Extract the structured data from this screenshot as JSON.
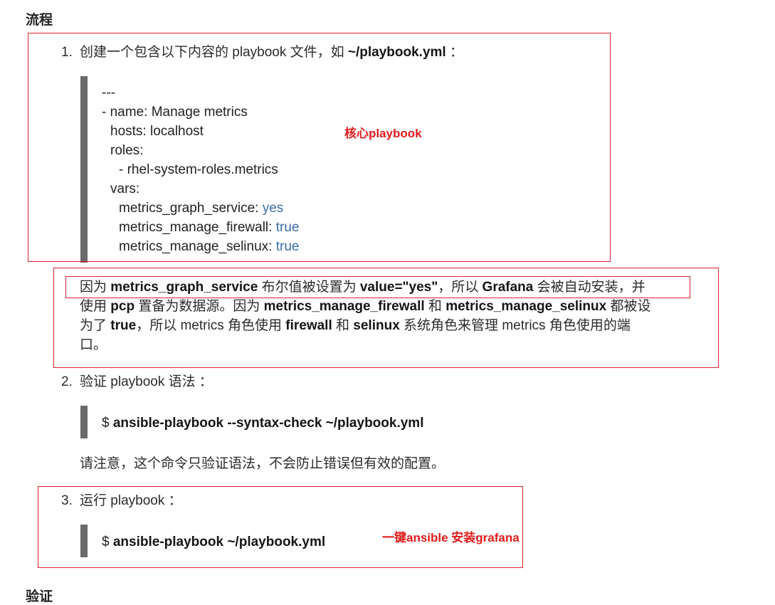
{
  "heading_flow": "流程",
  "heading_verify": "验证",
  "step1": {
    "number": "1.",
    "text_before": "创建一个包含以下内容的 playbook 文件，如 ",
    "path": "~/playbook.yml",
    "text_after": " ：",
    "code": {
      "line1": "---",
      "line2": "- name: Manage metrics",
      "line3": "hosts: localhost",
      "line4": "roles:",
      "line5": "- rhel-system-roles.metrics",
      "line6": "vars:",
      "line7_key": "metrics_graph_service: ",
      "line7_val": "yes",
      "line8_key": "metrics_manage_firewall: ",
      "line8_val": "true",
      "line9_key": "metrics_manage_selinux: ",
      "line9_val": "true"
    },
    "annotation": "核心playbook"
  },
  "explanation": {
    "l1_a": "因为 ",
    "l1_b": "metrics_graph_service",
    "l1_c": " 布尔值被设置为 ",
    "l1_d": "value=\"yes\"",
    "l1_e": "，所以 ",
    "l1_f": "Grafana",
    "l1_g": " 会被自动安装，并",
    "l2_a": "使用 ",
    "l2_b": "pcp",
    "l2_c": " 置备为数据源。因为 ",
    "l2_d": "metrics_manage_firewall",
    "l2_e": " 和 ",
    "l2_f": "metrics_manage_selinux",
    "l2_g": " 都被设",
    "l3_a": "为了 ",
    "l3_b": "true",
    "l3_c": "，所以 metrics 角色使用 ",
    "l3_d": "firewall",
    "l3_e": " 和 ",
    "l3_f": "selinux",
    "l3_g": " 系统角色来管理 metrics 角色使用的端",
    "l4": "口。"
  },
  "step2": {
    "number": "2.",
    "text": "验证 playbook 语法 ：",
    "prompt": "$ ",
    "command": "ansible-playbook --syntax-check ~/playbook.yml",
    "note": "请注意，这个命令只验证语法，不会防止错误但有效的配置。"
  },
  "step3": {
    "number": "3.",
    "text": "运行 playbook ：",
    "prompt": "$ ",
    "command": "ansible-playbook ~/playbook.yml",
    "annotation": "一键ansible 安装grafana"
  },
  "colors": {
    "annotation_red": "#e21c1c",
    "box_red": "#d9232d",
    "keyword_blue": "#3b6cae",
    "code_bar_gray": "#6a6a6a"
  }
}
